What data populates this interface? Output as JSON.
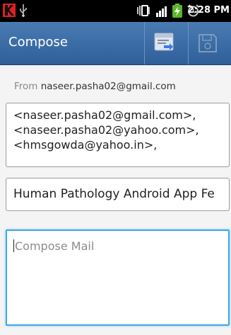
{
  "status_bar": {
    "time": "2:28 PM",
    "icons": [
      "app-notification-icon",
      "usb-icon",
      "vibrate-icon",
      "signal-icon",
      "battery-icon",
      "alarm-icon"
    ]
  },
  "action_bar": {
    "title": "Compose",
    "send_icon": "send-mail-icon",
    "save_icon": "save-draft-icon",
    "color": "#3a6ca8"
  },
  "form": {
    "from_label": "From",
    "from_value": "naseer.pasha02@gmail.com",
    "to_lines": [
      "<naseer.pasha02@gmail.com>,",
      "<naseer.pasha02@yahoo.com>,",
      "<hmsgowda@yahoo.in>,"
    ],
    "subject": "Human Pathology Android App Fe",
    "body_placeholder": "Compose Mail",
    "focus_color": "#3ea8e8"
  }
}
